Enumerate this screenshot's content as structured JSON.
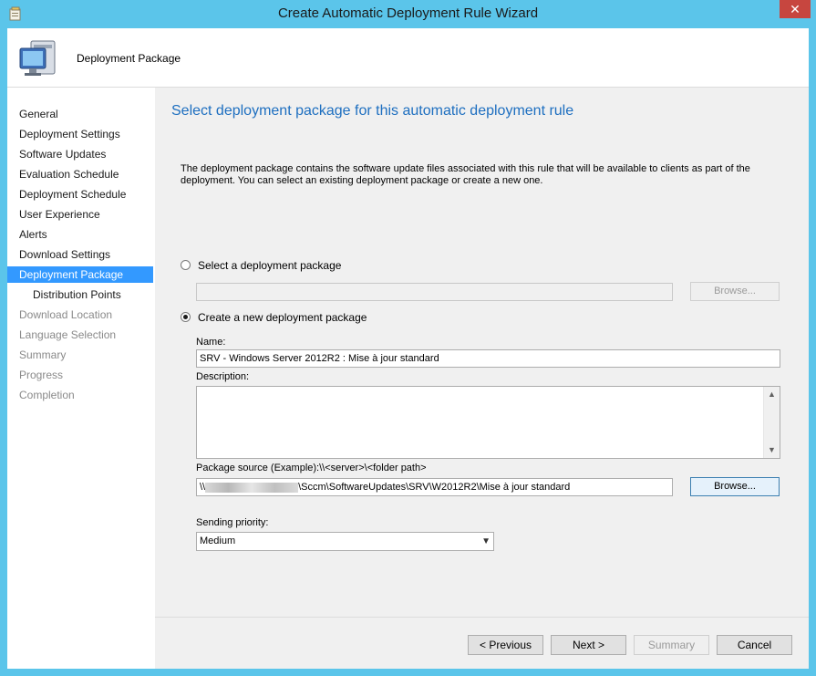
{
  "window": {
    "title": "Create Automatic Deployment Rule Wizard",
    "close_label": "✕"
  },
  "header": {
    "title": "Deployment Package",
    "icon": "computer-monitor-icon"
  },
  "nav": {
    "items": [
      {
        "label": "General",
        "state": "normal"
      },
      {
        "label": "Deployment Settings",
        "state": "normal"
      },
      {
        "label": "Software Updates",
        "state": "normal"
      },
      {
        "label": "Evaluation Schedule",
        "state": "normal"
      },
      {
        "label": "Deployment Schedule",
        "state": "normal"
      },
      {
        "label": "User Experience",
        "state": "normal"
      },
      {
        "label": "Alerts",
        "state": "normal"
      },
      {
        "label": "Download Settings",
        "state": "normal"
      },
      {
        "label": "Deployment Package",
        "state": "active"
      },
      {
        "label": "Distribution Points",
        "state": "sub"
      },
      {
        "label": "Download Location",
        "state": "disabled"
      },
      {
        "label": "Language Selection",
        "state": "disabled"
      },
      {
        "label": "Summary",
        "state": "disabled"
      },
      {
        "label": "Progress",
        "state": "disabled"
      },
      {
        "label": "Completion",
        "state": "disabled"
      }
    ]
  },
  "main": {
    "heading": "Select deployment package for this automatic deployment rule",
    "description": "The deployment package contains the software update files associated with this rule that will be available to clients as part of the deployment. You can select an existing deployment package or create a new one.",
    "option_existing": {
      "label": "Select a deployment package",
      "checked": false,
      "value": "",
      "browse_label": "Browse..."
    },
    "option_new": {
      "label": "Create a new deployment package",
      "checked": true
    },
    "name": {
      "label": "Name:",
      "value": "SRV - Windows Server 2012R2 : Mise à jour standard"
    },
    "description_field": {
      "label": "Description:",
      "value": ""
    },
    "package_source": {
      "label": "Package source (Example):\\\\<server>\\<folder path>",
      "value_prefix": "\\\\",
      "value_suffix": "\\Sccm\\SoftwareUpdates\\SRV\\W2012R2\\Mise à jour standard",
      "browse_label": "Browse..."
    },
    "sending_priority": {
      "label": "Sending priority:",
      "value": "Medium"
    }
  },
  "footer": {
    "previous_label": "< Previous",
    "next_label": "Next >",
    "summary_label": "Summary",
    "cancel_label": "Cancel"
  },
  "colors": {
    "title_bar": "#5bc5ea",
    "heading": "#1e6fc0",
    "nav_active": "#3399ff"
  }
}
